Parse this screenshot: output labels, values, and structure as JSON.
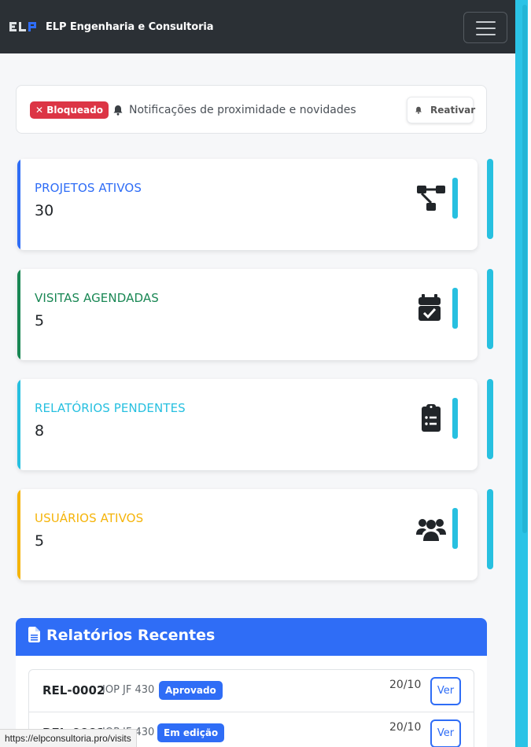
{
  "navbar": {
    "brand_title": "ELP Engenharia e Consultoria",
    "logo_colors": {
      "E": "#e8e8e8",
      "L": "#e8e8e8",
      "P": "#2f6df6"
    }
  },
  "notification": {
    "badge": "✕ Bloqueado",
    "text": "Notificações de proximidade e novidades",
    "reactivate_label": "Reativar"
  },
  "stats": [
    {
      "label": "PROJETOS ATIVOS",
      "value": "30",
      "color": "#2f6df6",
      "icon": "project-diagram-icon"
    },
    {
      "label": "VISITAS AGENDADAS",
      "value": "5",
      "color": "#198754",
      "icon": "calendar-check-icon"
    },
    {
      "label": "RELATÓRIOS PENDENTES",
      "value": "8",
      "color": "#27c0e0",
      "icon": "clipboard-list-icon"
    },
    {
      "label": "USUÁRIOS ATIVOS",
      "value": "5",
      "color": "#f5b40a",
      "icon": "users-icon"
    }
  ],
  "recent": {
    "title": "Relatórios Recentes",
    "rows": [
      {
        "code": "REL-0002",
        "project": "IOP JF 430",
        "status": "Aprovado",
        "status_color": "#2f6df6",
        "date": "20/10",
        "action": "Ver"
      },
      {
        "code": "REL-0001",
        "project": "IOP JF 430",
        "status": "Em edição",
        "status_color": "#2f6df6",
        "date": "20/10",
        "action": "Ver"
      }
    ]
  },
  "status_url": "https://elpconsultoria.pro/visits"
}
